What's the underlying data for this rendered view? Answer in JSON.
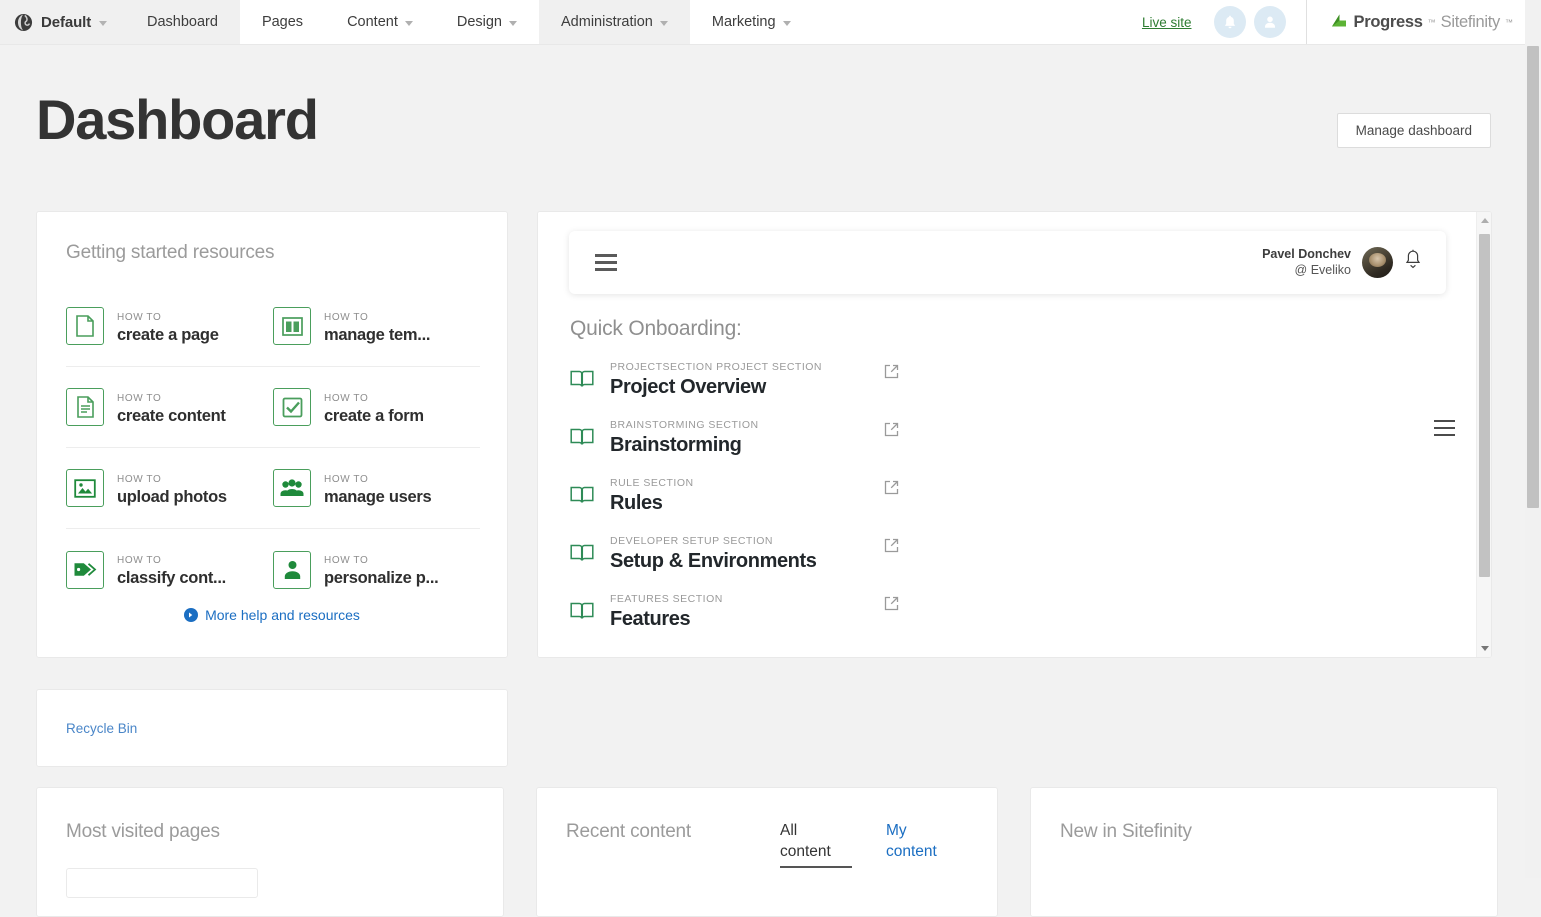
{
  "topbar": {
    "site_selector": {
      "label": "Default",
      "icon": "globe-icon"
    },
    "tabs": [
      {
        "label": "Dashboard",
        "active": true,
        "has_caret": false
      },
      {
        "label": "Pages",
        "active": false,
        "has_caret": false
      },
      {
        "label": "Content",
        "active": false,
        "has_caret": true
      },
      {
        "label": "Design",
        "active": false,
        "has_caret": true
      },
      {
        "label": "Administration",
        "active": true,
        "has_caret": true
      },
      {
        "label": "Marketing",
        "active": false,
        "has_caret": true
      }
    ],
    "live_site_label": "Live site",
    "notifications_icon": "bell-icon",
    "account_icon": "user-avatar-icon",
    "brand": {
      "progress": "Progress",
      "sitefinity": "Sitefinity",
      "tm": "™",
      "logo_icon": "progress-arrow-logo-icon"
    }
  },
  "page": {
    "title": "Dashboard",
    "manage_dashboard_label": "Manage dashboard"
  },
  "getting_started": {
    "title": "Getting started resources",
    "how_to_label": "HOW TO",
    "items": [
      {
        "how": "HOW TO",
        "label": "create a page",
        "icon": "page-document-icon"
      },
      {
        "how": "HOW TO",
        "label": "manage tem...",
        "icon": "template-layout-icon"
      },
      {
        "how": "HOW TO",
        "label": "create content",
        "icon": "content-lines-icon"
      },
      {
        "how": "HOW TO",
        "label": "create a form",
        "icon": "checkbox-check-icon"
      },
      {
        "how": "HOW TO",
        "label": "upload photos",
        "icon": "image-photo-icon"
      },
      {
        "how": "HOW TO",
        "label": "manage users",
        "icon": "users-group-icon"
      },
      {
        "how": "HOW TO",
        "label": "classify cont...",
        "icon": "tag-label-icon"
      },
      {
        "how": "HOW TO",
        "label": "personalize p...",
        "icon": "person-icon"
      }
    ],
    "more_help_label": "More help and resources"
  },
  "recycle_bin": {
    "label": "Recycle Bin"
  },
  "embedded_widget": {
    "menu_icon": "hamburger-menu-icon",
    "user": {
      "name": "Pavel Donchev",
      "handle": "@ Eveliko",
      "avatar": "user-photo-avatar",
      "bell": "bell-dropdown-icon"
    },
    "quick_onboarding_title": "Quick Onboarding:",
    "items": [
      {
        "section": "PROJECTSECTION PROJECT SECTION",
        "name": "Project Overview",
        "icon": "open-book-icon",
        "link_icon": "external-link-icon"
      },
      {
        "section": "BRAINSTORMING SECTION",
        "name": "Brainstorming",
        "icon": "open-book-icon",
        "link_icon": "external-link-icon"
      },
      {
        "section": "RULE SECTION",
        "name": "Rules",
        "icon": "open-book-icon",
        "link_icon": "external-link-icon"
      },
      {
        "section": "DEVELOPER SETUP SECTION",
        "name": "Setup & Environments",
        "icon": "open-book-icon",
        "link_icon": "external-link-icon"
      },
      {
        "section": "FEATURES SECTION",
        "name": "Features",
        "icon": "open-book-icon",
        "link_icon": "external-link-icon"
      }
    ]
  },
  "most_visited": {
    "title": "Most visited pages"
  },
  "recent_content": {
    "title": "Recent content",
    "tabs": [
      {
        "label": "All content",
        "active": true
      },
      {
        "label": "My content",
        "active": false
      }
    ]
  },
  "new_in_sitefinity": {
    "title": "New in Sitefinity"
  },
  "colors": {
    "accent_green": "#4a9e5c",
    "link_blue": "#1b6ec2",
    "brand_green": "#5cb335",
    "title_gray": "#9b9b9b",
    "tab_active_bg": "#f0f0f0"
  }
}
